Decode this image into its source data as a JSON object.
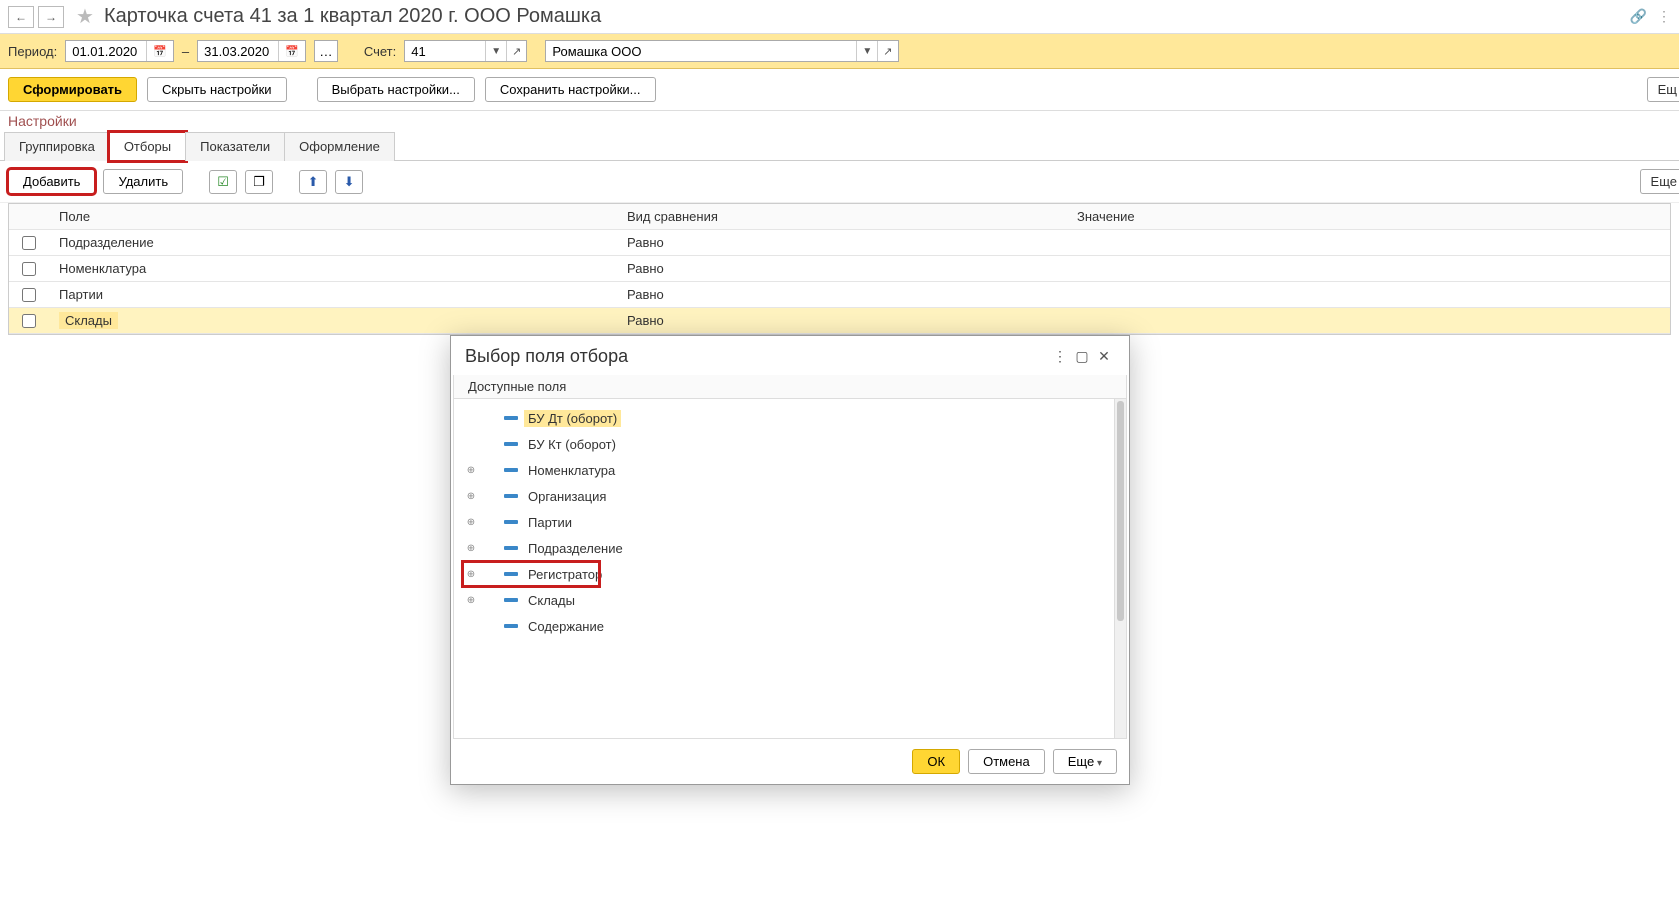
{
  "titlebar": {
    "title": "Карточка счета 41 за 1 квартал 2020 г. ООО Ромашка"
  },
  "period": {
    "label": "Период:",
    "from": "01.01.2020",
    "to": "31.03.2020",
    "account_label": "Счет:",
    "account": "41",
    "org": "Ромашка ООО"
  },
  "actions": {
    "form": "Сформировать",
    "hide_settings": "Скрыть настройки",
    "choose_settings": "Выбрать настройки...",
    "save_settings": "Сохранить настройки...",
    "more_cut": "Ещ"
  },
  "settings_title": "Настройки",
  "tabs": {
    "grouping": "Группировка",
    "filters": "Отборы",
    "measures": "Показатели",
    "design": "Оформление"
  },
  "filterbar": {
    "add": "Добавить",
    "delete": "Удалить",
    "more_cut": "Еще"
  },
  "grid": {
    "headers": {
      "field": "Поле",
      "cmp": "Вид сравнения",
      "value": "Значение"
    },
    "rows": [
      {
        "field": "Подразделение",
        "cmp": "Равно",
        "selected": false
      },
      {
        "field": "Номенклатура",
        "cmp": "Равно",
        "selected": false
      },
      {
        "field": "Партии",
        "cmp": "Равно",
        "selected": false
      },
      {
        "field": "Склады",
        "cmp": "Равно",
        "selected": true
      }
    ]
  },
  "modal": {
    "title": "Выбор поля отбора",
    "subtitle": "Доступные поля",
    "tree": [
      {
        "label": "БУ Дт (оборот)",
        "expand": false,
        "selected": true
      },
      {
        "label": "БУ Кт (оборот)",
        "expand": false,
        "selected": false
      },
      {
        "label": "Номенклатура",
        "expand": true,
        "selected": false
      },
      {
        "label": "Организация",
        "expand": true,
        "selected": false
      },
      {
        "label": "Партии",
        "expand": true,
        "selected": false
      },
      {
        "label": "Подразделение",
        "expand": true,
        "selected": false
      },
      {
        "label": "Регистратор",
        "expand": true,
        "selected": false,
        "red": true
      },
      {
        "label": "Склады",
        "expand": true,
        "selected": false
      },
      {
        "label": "Содержание",
        "expand": false,
        "selected": false
      }
    ],
    "ok": "ОК",
    "cancel": "Отмена",
    "more": "Еще"
  }
}
